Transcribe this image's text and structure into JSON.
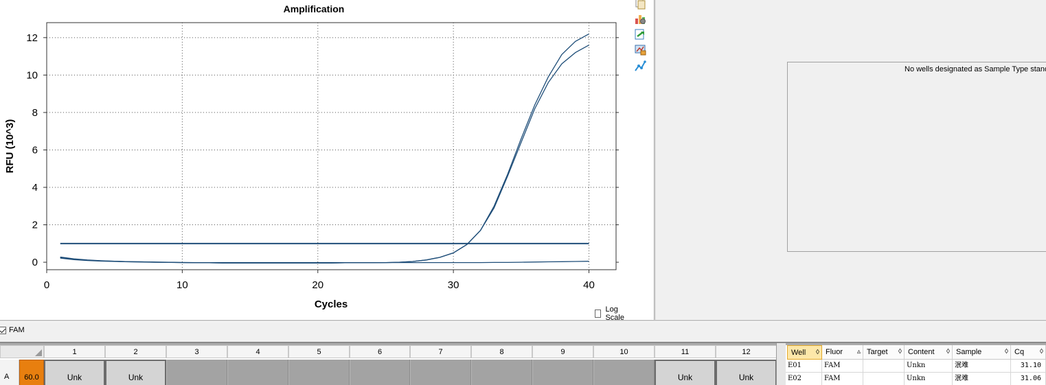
{
  "chart": {
    "title": "Amplification",
    "xlabel": "Cycles",
    "ylabel": "RFU (10^3)",
    "log_scale_label": "Log Scale",
    "log_scale_checked": false
  },
  "chart_data": {
    "type": "line",
    "title": "Amplification",
    "xlabel": "Cycles",
    "ylabel": "RFU (10^3)",
    "xlim": [
      0,
      42
    ],
    "ylim": [
      -0.4,
      12.8
    ],
    "xticks": [
      0,
      10,
      20,
      30,
      40
    ],
    "yticks": [
      0,
      2,
      4,
      6,
      8,
      10,
      12
    ],
    "grid": true,
    "line_color": "#1f4e79",
    "threshold": 1.0,
    "series": [
      {
        "x": [
          1,
          2,
          3,
          4,
          5,
          6,
          7,
          8,
          9,
          10,
          11,
          12,
          13,
          14,
          15,
          16,
          17,
          18,
          19,
          20,
          21,
          22,
          23,
          24,
          25,
          26,
          27,
          28,
          29,
          30,
          31,
          32,
          33,
          34,
          35,
          36,
          37,
          38,
          39,
          40
        ],
        "values": [
          0.28,
          0.18,
          0.12,
          0.08,
          0.05,
          0.03,
          0.02,
          0.01,
          0.0,
          -0.02,
          -0.03,
          -0.03,
          -0.04,
          -0.04,
          -0.04,
          -0.04,
          -0.04,
          -0.04,
          -0.04,
          -0.04,
          -0.04,
          -0.03,
          -0.03,
          -0.03,
          -0.02,
          0.0,
          0.04,
          0.12,
          0.26,
          0.5,
          0.95,
          1.7,
          3.0,
          4.7,
          6.6,
          8.4,
          9.9,
          11.1,
          11.8,
          12.2
        ]
      },
      {
        "x": [
          1,
          2,
          3,
          4,
          5,
          6,
          7,
          8,
          9,
          10,
          11,
          12,
          13,
          14,
          15,
          16,
          17,
          18,
          19,
          20,
          21,
          22,
          23,
          24,
          25,
          26,
          27,
          28,
          29,
          30,
          31,
          32,
          33,
          34,
          35,
          36,
          37,
          38,
          39,
          40
        ],
        "values": [
          0.25,
          0.16,
          0.11,
          0.07,
          0.05,
          0.03,
          0.02,
          0.0,
          -0.01,
          -0.02,
          -0.03,
          -0.03,
          -0.04,
          -0.04,
          -0.04,
          -0.04,
          -0.04,
          -0.04,
          -0.04,
          -0.04,
          -0.04,
          -0.03,
          -0.03,
          -0.03,
          -0.02,
          0.0,
          0.04,
          0.12,
          0.26,
          0.5,
          0.95,
          1.7,
          2.9,
          4.6,
          6.4,
          8.2,
          9.6,
          10.6,
          11.2,
          11.6
        ]
      },
      {
        "x": [
          1,
          2,
          3,
          4,
          5,
          6,
          7,
          8,
          9,
          10,
          11,
          12,
          13,
          14,
          15,
          16,
          17,
          18,
          19,
          20,
          21,
          22,
          23,
          24,
          25,
          26,
          27,
          28,
          29,
          30,
          31,
          32,
          33,
          34,
          35,
          36,
          37,
          38,
          39,
          40
        ],
        "values": [
          0.22,
          0.14,
          0.09,
          0.06,
          0.04,
          0.02,
          0.01,
          0.0,
          -0.01,
          -0.01,
          -0.02,
          -0.02,
          -0.02,
          -0.02,
          -0.02,
          -0.02,
          -0.02,
          -0.02,
          -0.02,
          -0.02,
          -0.02,
          -0.02,
          -0.02,
          -0.02,
          -0.02,
          -0.02,
          -0.02,
          -0.02,
          -0.02,
          -0.02,
          -0.02,
          -0.02,
          -0.01,
          -0.01,
          0.0,
          0.01,
          0.02,
          0.03,
          0.04,
          0.05
        ]
      }
    ]
  },
  "toolbar": {
    "icons": [
      "copy-icon",
      "chart-settings-icon",
      "export-icon",
      "print-chart-icon",
      "chart-options-icon"
    ]
  },
  "standard_curve": {
    "message": "No wells designated as Sample Type standard"
  },
  "fluor": {
    "label": "FAM",
    "checked": true
  },
  "plate": {
    "columns": [
      "1",
      "2",
      "3",
      "4",
      "5",
      "6",
      "7",
      "8",
      "9",
      "10",
      "11",
      "12"
    ],
    "row_label": "A",
    "row_value": "60.0",
    "wells": [
      "Unk",
      "Unk",
      "",
      "",
      "",
      "",
      "",
      "",
      "",
      "",
      "Unk",
      "Unk"
    ]
  },
  "well_table": {
    "headers": [
      "Well",
      "Fluor",
      "Target",
      "Content",
      "Sample",
      "Cq"
    ],
    "rows": [
      {
        "well": "E01",
        "fluor": "FAM",
        "target": "",
        "content": "Unkn",
        "sample": "泯难",
        "cq": "31.10"
      },
      {
        "well": "E02",
        "fluor": "FAM",
        "target": "",
        "content": "Unkn",
        "sample": "泯难",
        "cq": "31.06"
      }
    ]
  },
  "colors": {
    "curve": "#1f4e79",
    "temp_cell": "#e87f0f",
    "selected_header": "#fde7a9"
  }
}
